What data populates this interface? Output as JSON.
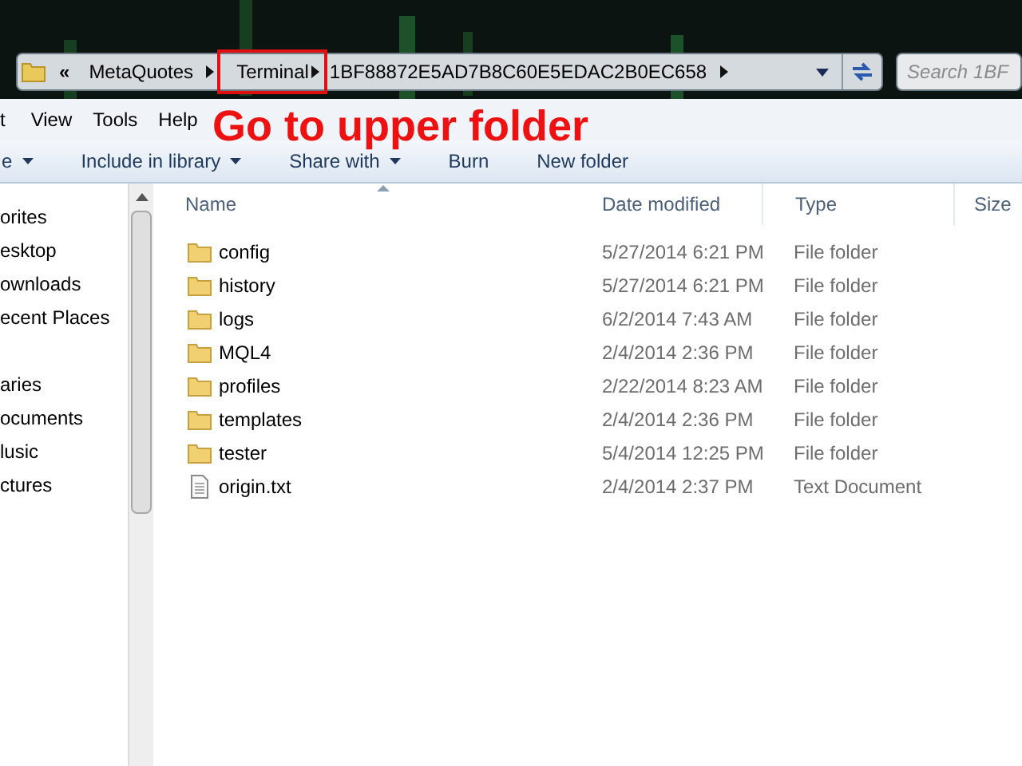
{
  "address_bar": {
    "overflow": "«",
    "crumbs": [
      {
        "label": "MetaQuotes",
        "highlighted": false
      },
      {
        "label": "Terminal",
        "highlighted": true
      },
      {
        "label": "1BF88872E5AD7B8C60E5EDAC2B0EC658",
        "highlighted": false
      }
    ]
  },
  "search": {
    "placeholder": "Search 1BF"
  },
  "menu": [
    "t",
    "View",
    "Tools",
    "Help"
  ],
  "toolbar": [
    {
      "label": "e",
      "dropdown": true
    },
    {
      "label": "Include in library",
      "dropdown": true
    },
    {
      "label": "Share with",
      "dropdown": true
    },
    {
      "label": "Burn",
      "dropdown": false
    },
    {
      "label": "New folder",
      "dropdown": false
    }
  ],
  "nav": [
    {
      "label": "orites",
      "kind": "group"
    },
    {
      "label": "esktop",
      "kind": "item"
    },
    {
      "label": "ownloads",
      "kind": "item"
    },
    {
      "label": "ecent Places",
      "kind": "item"
    },
    {
      "label": "aries",
      "kind": "group"
    },
    {
      "label": "ocuments",
      "kind": "item"
    },
    {
      "label": "lusic",
      "kind": "item"
    },
    {
      "label": "ctures",
      "kind": "item"
    }
  ],
  "columns": [
    "Name",
    "Date modified",
    "Type",
    "Size"
  ],
  "rows": [
    {
      "name": "config",
      "date": "5/27/2014 6:21 PM",
      "type": "File folder",
      "kind": "folder"
    },
    {
      "name": "history",
      "date": "5/27/2014 6:21 PM",
      "type": "File folder",
      "kind": "folder"
    },
    {
      "name": "logs",
      "date": "6/2/2014 7:43 AM",
      "type": "File folder",
      "kind": "folder"
    },
    {
      "name": "MQL4",
      "date": "2/4/2014 2:36 PM",
      "type": "File folder",
      "kind": "folder"
    },
    {
      "name": "profiles",
      "date": "2/22/2014 8:23 AM",
      "type": "File folder",
      "kind": "folder"
    },
    {
      "name": "templates",
      "date": "2/4/2014 2:36 PM",
      "type": "File folder",
      "kind": "folder"
    },
    {
      "name": "tester",
      "date": "5/4/2014 12:25 PM",
      "type": "File folder",
      "kind": "folder"
    },
    {
      "name": "origin.txt",
      "date": "2/4/2014 2:37 PM",
      "type": "Text Document",
      "kind": "file"
    }
  ],
  "annotation": {
    "text": "Go to upper folder"
  }
}
